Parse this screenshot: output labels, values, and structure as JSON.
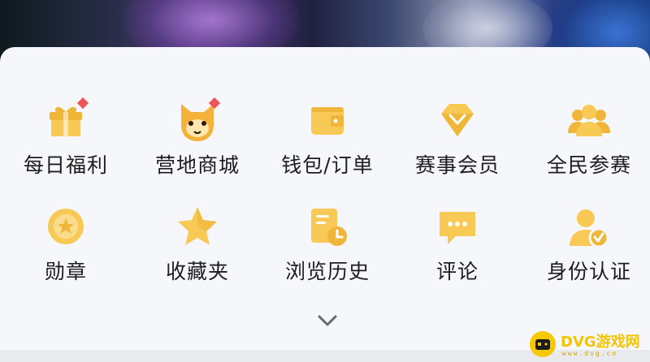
{
  "colors": {
    "accent": "#f8c954",
    "accent_dark": "#f0b63a",
    "badge": "#f0545a",
    "text": "#1d1d1f",
    "sheet": "#f6f7fa"
  },
  "menu": {
    "row1": [
      {
        "label": "每日福利",
        "icon": "gift-icon",
        "badge": true
      },
      {
        "label": "营地商城",
        "icon": "cat-mascot-icon",
        "badge": true
      },
      {
        "label": "钱包/订单",
        "icon": "wallet-icon",
        "badge": false
      },
      {
        "label": "赛事会员",
        "icon": "diamond-icon",
        "badge": false
      },
      {
        "label": "全民参赛",
        "icon": "group-icon",
        "badge": false
      }
    ],
    "row2": [
      {
        "label": "勋章",
        "icon": "medal-icon"
      },
      {
        "label": "收藏夹",
        "icon": "star-icon"
      },
      {
        "label": "浏览历史",
        "icon": "history-icon"
      },
      {
        "label": "评论",
        "icon": "comment-icon"
      },
      {
        "label": "身份认证",
        "icon": "verified-user-icon"
      }
    ]
  },
  "watermark": {
    "name": "DVG游戏网",
    "site": "www.dvg.cn"
  }
}
